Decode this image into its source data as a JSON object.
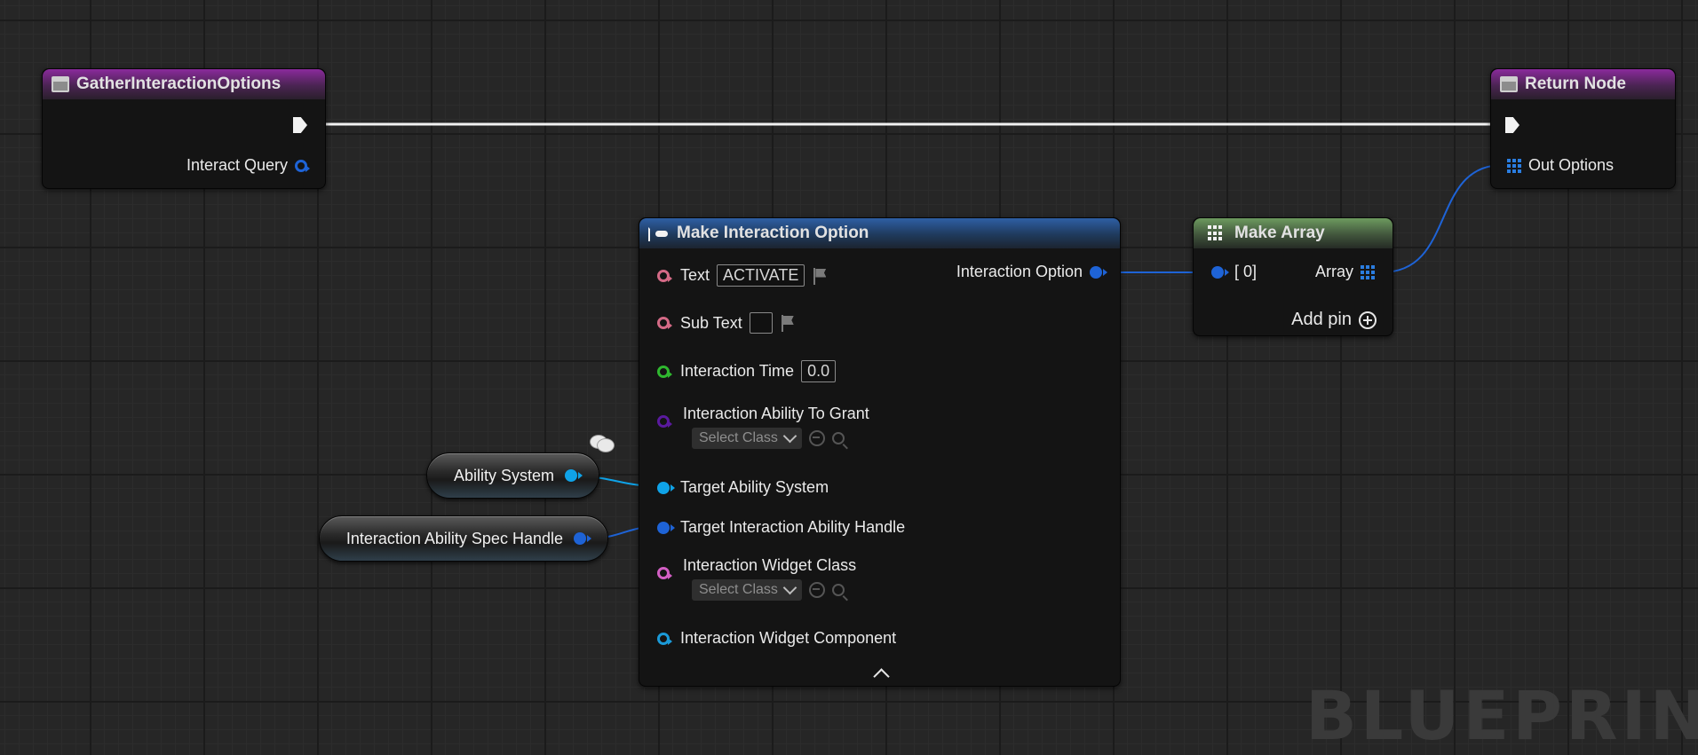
{
  "colors": {
    "function_header": "#8a2a9c",
    "struct_header": "#2e5fa4",
    "array_header": "#6d9a5f",
    "text_pin": "#d46a86",
    "float_pin": "#2fb82f",
    "class_pin": "#5a1a9e",
    "struct_pin": "#1e63d6",
    "object_pin": "#0fa3e8",
    "widget_class_pin": "#d35fc4",
    "widget_component_pin": "#1b9ad8",
    "exec_wire": "#f2f2f2"
  },
  "entry_node": {
    "title": "GatherInteractionOptions",
    "output_label": "Interact Query"
  },
  "return_node": {
    "title": "Return Node",
    "input_label": "Out Options"
  },
  "make_struct": {
    "title": "Make Interaction Option",
    "output_label": "Interaction Option",
    "pins": {
      "text_label": "Text",
      "text_value": "ACTIVATE",
      "subtext_label": "Sub Text",
      "time_label": "Interaction Time",
      "time_value": "0.0",
      "ability_grant_label": "Interaction Ability To Grant",
      "ability_grant_select": "Select Class",
      "target_ability_system_label": "Target Ability System",
      "target_handle_label": "Target Interaction Ability Handle",
      "widget_class_label": "Interaction Widget Class",
      "widget_class_select": "Select Class",
      "widget_component_label": "Interaction Widget Component"
    },
    "collapse_icon": "chevron-up-icon"
  },
  "make_array": {
    "title": "Make Array",
    "input_label": "[ 0]",
    "output_label": "Array",
    "add_pin_label": "Add pin"
  },
  "variables": {
    "ability_system": "Ability System",
    "spec_handle": "Interaction Ability Spec Handle"
  },
  "watermark": "BLUEPRINT"
}
